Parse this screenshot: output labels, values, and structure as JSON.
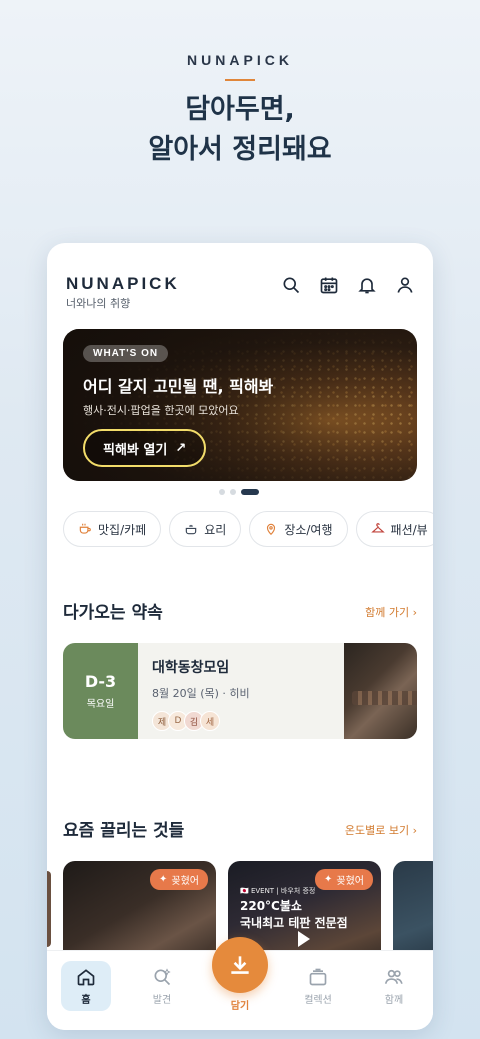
{
  "promo": {
    "brand": "NUNAPICK",
    "headline_line1": "담아두면,",
    "headline_line2": "알아서 정리돼요"
  },
  "header": {
    "logo": "NUNAPICK",
    "tagline": "너와나의 취향",
    "icons": [
      "search-icon",
      "calendar-icon",
      "bell-icon",
      "profile-icon"
    ]
  },
  "banner": {
    "badge": "WHAT'S ON",
    "title": "어디 갈지 고민될 땐, 픽해봐",
    "subtitle": "행사·전시·팝업을 한곳에 모았어요",
    "button_label": "픽해봐 열기",
    "button_arrow": "↗",
    "dots_total": 3,
    "dots_active": 3
  },
  "categories": [
    {
      "label": "맛집/카페",
      "icon": "cup-icon"
    },
    {
      "label": "요리",
      "icon": "pot-icon"
    },
    {
      "label": "장소/여행",
      "icon": "location-pin-icon"
    },
    {
      "label": "패션/뷰",
      "icon": "hanger-icon"
    }
  ],
  "upcoming": {
    "title": "다가오는 약속",
    "link": "함께 가기 ›",
    "item": {
      "dday": "D-3",
      "weekday": "목요일",
      "name": "대학동창모임",
      "meta": "8월 20일 (목) · 히비",
      "members": [
        "제",
        "D",
        "김",
        "세"
      ]
    }
  },
  "trending": {
    "title": "요즘 끌리는 것들",
    "link": "온도별로 보기 ›",
    "cards": [
      {
        "tag": "꽂혔어"
      },
      {
        "tag": "꽂혔어",
        "event": "🇯🇵 EVENT | 바우처 증정",
        "headline1": "220°C불쇼",
        "headline2": "국내최고 테판 전문점"
      }
    ]
  },
  "tabbar": {
    "home": "홈",
    "discover": "발견",
    "save": "담기",
    "collection": "컬렉션",
    "together": "함께"
  },
  "colors": {
    "accent": "#e58a3c",
    "navy": "#1e2a3a",
    "green": "#6b8a5c",
    "tag": "#e7794a"
  }
}
